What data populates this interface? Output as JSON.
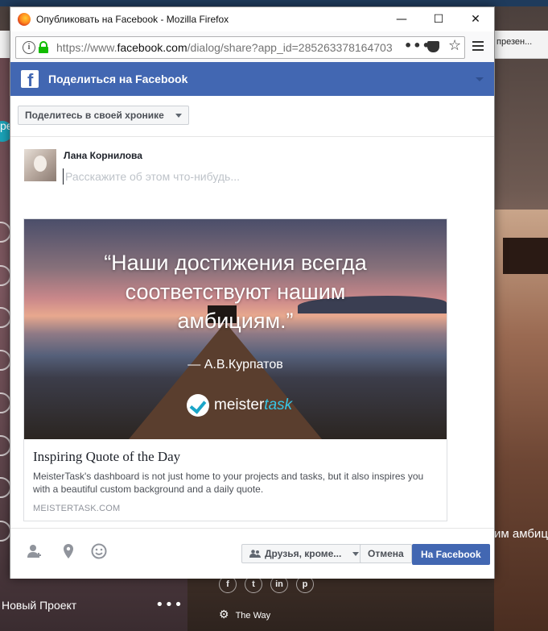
{
  "window": {
    "title": "Опубликовать на Facebook - Mozilla Firefox",
    "minimize": "—",
    "maximize": "☐",
    "close": "✕"
  },
  "addressbar": {
    "url_prefix": "https://www.",
    "url_domain": "facebook.com",
    "url_rest": "/dialog/share?app_id=285263378164703",
    "more": "•••"
  },
  "dialog": {
    "header_title": "Поделиться на Facebook",
    "share_target": "Поделитесь в своей хронике",
    "user_name": "Лана Корнилова",
    "input_placeholder": "Расскажите об этом что-нибудь...",
    "input_value": ""
  },
  "card": {
    "quote_line1": "“Наши достижения всегда",
    "quote_line2": "соответствуют нашим",
    "quote_line3": "амбициям.”",
    "author": "— А.В.Курпатов",
    "logo_meister": "meister",
    "logo_task": "task",
    "title": "Inspiring Quote of the Day",
    "description": "MeisterTask's dashboard is not just home to your projects and tasks, but it also inspires you with a beautiful custom background and a daily quote.",
    "domain": "MEISTERTASK.COM"
  },
  "footer": {
    "audience": "Друзья, кроме...",
    "cancel": "Отмена",
    "post": "На Facebook"
  },
  "background": {
    "bookmark": "презен...",
    "left_text": "ре",
    "project": "Новый Проект",
    "dots": "•••",
    "quote_fragment": "им амбиц",
    "social": [
      "f",
      "t",
      "in",
      "p"
    ],
    "theway": "The Way"
  },
  "colors": {
    "facebook_blue": "#4267b2",
    "meistertask_accent": "#1aa5c8"
  }
}
